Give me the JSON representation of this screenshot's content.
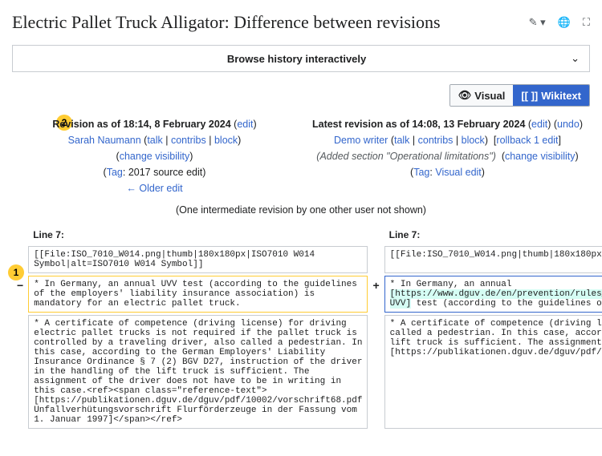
{
  "title": "Electric Pallet Truck Alligator: Difference between revisions",
  "history_bar": "Browse history interactively",
  "view": {
    "visual": "Visual",
    "wikitext": "Wikitext"
  },
  "markers": {
    "one": "1",
    "two": "2"
  },
  "left_rev": {
    "heading": "Revision as of 18:14, 8 February 2024",
    "edit": "edit",
    "user": "Sarah Naumann",
    "talk": "talk",
    "contribs": "contribs",
    "block": "block",
    "change_vis": "change visibility",
    "tag_label": "Tag",
    "tag_value": "2017 source edit",
    "older": "← Older edit"
  },
  "right_rev": {
    "heading": "Latest revision as of 14:08, 13 February 2024",
    "edit": "edit",
    "undo": "undo",
    "user": "Demo writer",
    "talk": "talk",
    "contribs": "contribs",
    "block": "block",
    "rollback": "rollback 1 edit",
    "summary": "(Added section \"Operational limitations\")",
    "change_vis": "change visibility",
    "tag_label": "Tag",
    "tag_value": "Visual edit"
  },
  "intermediate": "(One intermediate revision by one other user not shown)",
  "diff": {
    "line_label": "Line 7:",
    "row1": "[[File:ISO_7010_W014.png|thumb|180x180px|ISO7010 W014 Symbol|alt=ISO7010 W014 Symbol]]",
    "row2_left": "* In Germany, an annual UVV test (according to the guidelines of the employers' liability insurance association) is mandatory for an electric pallet truck.",
    "row2_right_pre": "* In Germany, an annual ",
    "row2_right_ins": "[https://www.dguv.de/en/prevention/rules_regulations/index.jsp#:~:text=The%20accident%20prevention%20regulations%20(UVVs,establishments%20or%20areas%20of%20activity. UVV]",
    "row2_right_post": " test (according to the guidelines of the employers' liability insurance association) is mandatory for an electric pallet truck.",
    "row3": "* A certificate of competence (driving license) for driving electric pallet trucks is not required if the pallet truck is controlled by a traveling driver, also called a pedestrian. In this case, according to the German Employers' Liability Insurance Ordinance § 7 (2) BGV D27, instruction of the driver in the handling of the lift truck is sufficient. The assignment of the driver does not have to be in writing in this case.<ref><span class=\"reference-text\">[https://publikationen.dguv.de/dguv/pdf/10002/vorschrift68.pdf Unfallverhütungsvorschrift Flurförderzeuge in der Fassung vom 1. Januar 1997]</span></ref>",
    "minus": "−",
    "plus": "+"
  }
}
